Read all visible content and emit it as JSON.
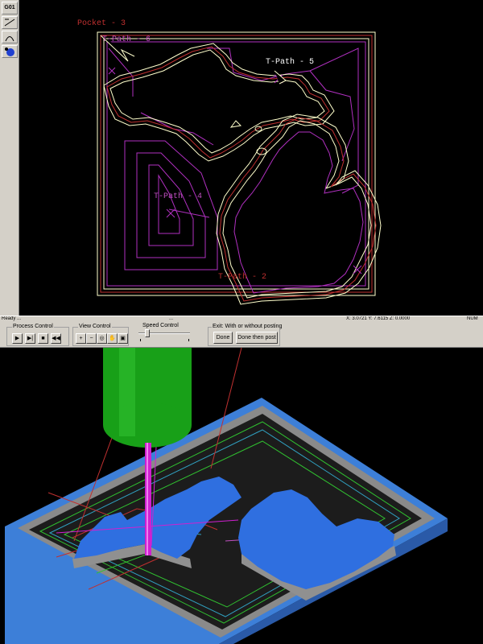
{
  "toolbar": {
    "g01_label": "G01",
    "icons": [
      "line-tool-icon",
      "arc-tool-icon",
      "sphere-tool-icon"
    ]
  },
  "cad": {
    "labels": {
      "pocket": "Pocket - 3",
      "tpath6": "T-Path - 6",
      "tpath5": "T-Path - 5",
      "tpath4": "T-Path - 4",
      "tpath2": "T-Path - 2"
    },
    "colors": {
      "outline": "#ffffcc",
      "path": "#b030c0",
      "label": "#c050c0",
      "red": "#c03030"
    }
  },
  "status": {
    "left_text": "Ready  ...",
    "mid_text": "...",
    "coords_text": "X: 3.0721   Y: 7.6115   Z: 0.0000",
    "right_text": "NUM"
  },
  "controls": {
    "process_title": "Process Control",
    "view_title": "View Control",
    "speed_title": "Speed Control",
    "exit_title": "Exit:  With or without posting",
    "done_label": "Done",
    "done_post_label": "Done then post",
    "process_buttons": [
      "▶",
      "▶|",
      "■",
      "◀◀"
    ],
    "view_buttons": [
      "+",
      "−",
      "◎",
      "✋",
      "▣"
    ]
  },
  "sim": {
    "colors": {
      "base": "#3d7fd8",
      "map": "#2f6fe0",
      "tool_shank": "#18a018",
      "tool_bit": "#d020d0"
    }
  }
}
